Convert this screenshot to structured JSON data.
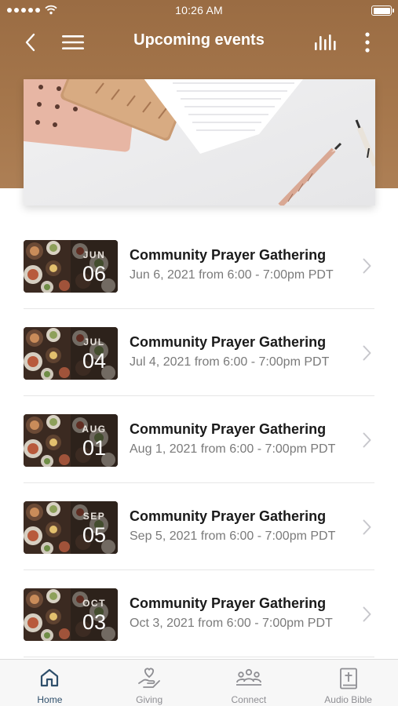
{
  "status_bar": {
    "time": "10:26 AM"
  },
  "nav": {
    "title": "Upcoming events",
    "icons": [
      "back-chevron-icon",
      "hamburger-menu-icon",
      "bar-chart-icon",
      "more-vertical-icon"
    ]
  },
  "hero": {
    "image": "desk-stationery-photo"
  },
  "events": [
    {
      "month": "JUN",
      "day": "06",
      "title": "Community Prayer Gathering",
      "subtitle": "Jun 6, 2021 from 6:00 - 7:00pm PDT"
    },
    {
      "month": "JUL",
      "day": "04",
      "title": "Community Prayer Gathering",
      "subtitle": "Jul 4, 2021 from 6:00 - 7:00pm PDT"
    },
    {
      "month": "AUG",
      "day": "01",
      "title": "Community Prayer Gathering",
      "subtitle": "Aug 1, 2021 from 6:00 - 7:00pm PDT"
    },
    {
      "month": "SEP",
      "day": "05",
      "title": "Community Prayer Gathering",
      "subtitle": "Sep 5, 2021 from 6:00 - 7:00pm PDT"
    },
    {
      "month": "OCT",
      "day": "03",
      "title": "Community Prayer Gathering",
      "subtitle": "Oct 3, 2021 from 6:00 - 7:00pm PDT"
    }
  ],
  "tabs": [
    {
      "label": "Home",
      "icon": "home-icon",
      "active": true
    },
    {
      "label": "Giving",
      "icon": "giving-hand-heart-icon",
      "active": false
    },
    {
      "label": "Connect",
      "icon": "people-group-icon",
      "active": false
    },
    {
      "label": "Audio Bible",
      "icon": "bible-icon",
      "active": false
    }
  ],
  "colors": {
    "header_brown": "#a6774c",
    "active_tab": "#2f4f6b",
    "inactive_tab": "#8e8e93",
    "title_text": "#1a1a1a",
    "subtitle_text": "#7a7a7a"
  }
}
